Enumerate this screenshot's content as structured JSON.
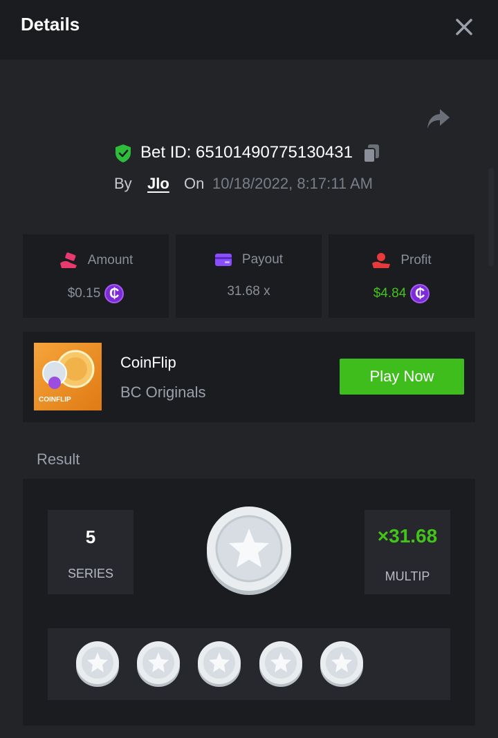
{
  "header": {
    "title": "Details"
  },
  "bet": {
    "id_label": "Bet ID: 65101490775130431",
    "by_label": "By",
    "user": "Jlo",
    "on_label": "On",
    "datetime": "10/18/2022, 8:17:11 AM"
  },
  "stats": [
    {
      "label": "Amount",
      "value": "$0.15",
      "icon": "money-hand-icon",
      "icon_color": "#e83a6e"
    },
    {
      "label": "Payout",
      "value": "31.68 x",
      "icon": "card-icon",
      "icon_color": "#8a4dff"
    },
    {
      "label": "Profit",
      "value": "$4.84",
      "icon": "hand-coin-icon",
      "icon_color": "#e83a3a"
    }
  ],
  "currency_symbol": "₵",
  "game": {
    "thumb_label": "COINFLIP",
    "name": "CoinFlip",
    "provider": "BC Originals",
    "play_label": "Play Now"
  },
  "result": {
    "section_label": "Result",
    "series_value": "5",
    "series_label": "SERIES",
    "multiplier_value": "×31.68",
    "multiplier_label": "MULTIP",
    "history": [
      "silver-star",
      "silver-star",
      "silver-star",
      "silver-star",
      "silver-star"
    ]
  },
  "colors": {
    "background": "#232428",
    "card": "#1b1c1f",
    "accent_green": "#3ebd1d",
    "coin_purple": "#7c2bd6"
  }
}
